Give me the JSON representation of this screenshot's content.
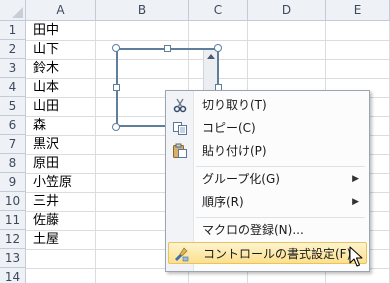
{
  "columns": [
    "A",
    "B",
    "C",
    "D",
    "E"
  ],
  "rows": [
    "1",
    "2",
    "3",
    "4",
    "5",
    "6",
    "7",
    "8",
    "9",
    "10",
    "11",
    "12",
    "13",
    "14"
  ],
  "cells": [
    "田中",
    "山下",
    "鈴木",
    "山本",
    "山田",
    "森",
    "黒沢",
    "原田",
    "小笠原",
    "三井",
    "佐藤",
    "土屋"
  ],
  "menu": {
    "cut": "切り取り(T)",
    "copy": "コピー(C)",
    "paste": "貼り付け(P)",
    "group": "グループ化(G)",
    "order": "順序(R)",
    "assign_macro": "マクロの登録(N)...",
    "format_control": "コントロールの書式設定(F)..."
  },
  "icons": {
    "cut": "scissors-icon",
    "copy": "copy-icon",
    "paste": "paste-icon",
    "format_control": "format-control-icon",
    "submenu": "chevron-right-icon"
  },
  "colors": {
    "header_bg": "#eef1f6",
    "grid": "#dadcdd",
    "highlight": "#fbe08c",
    "selection_border": "#5f7e9c"
  }
}
